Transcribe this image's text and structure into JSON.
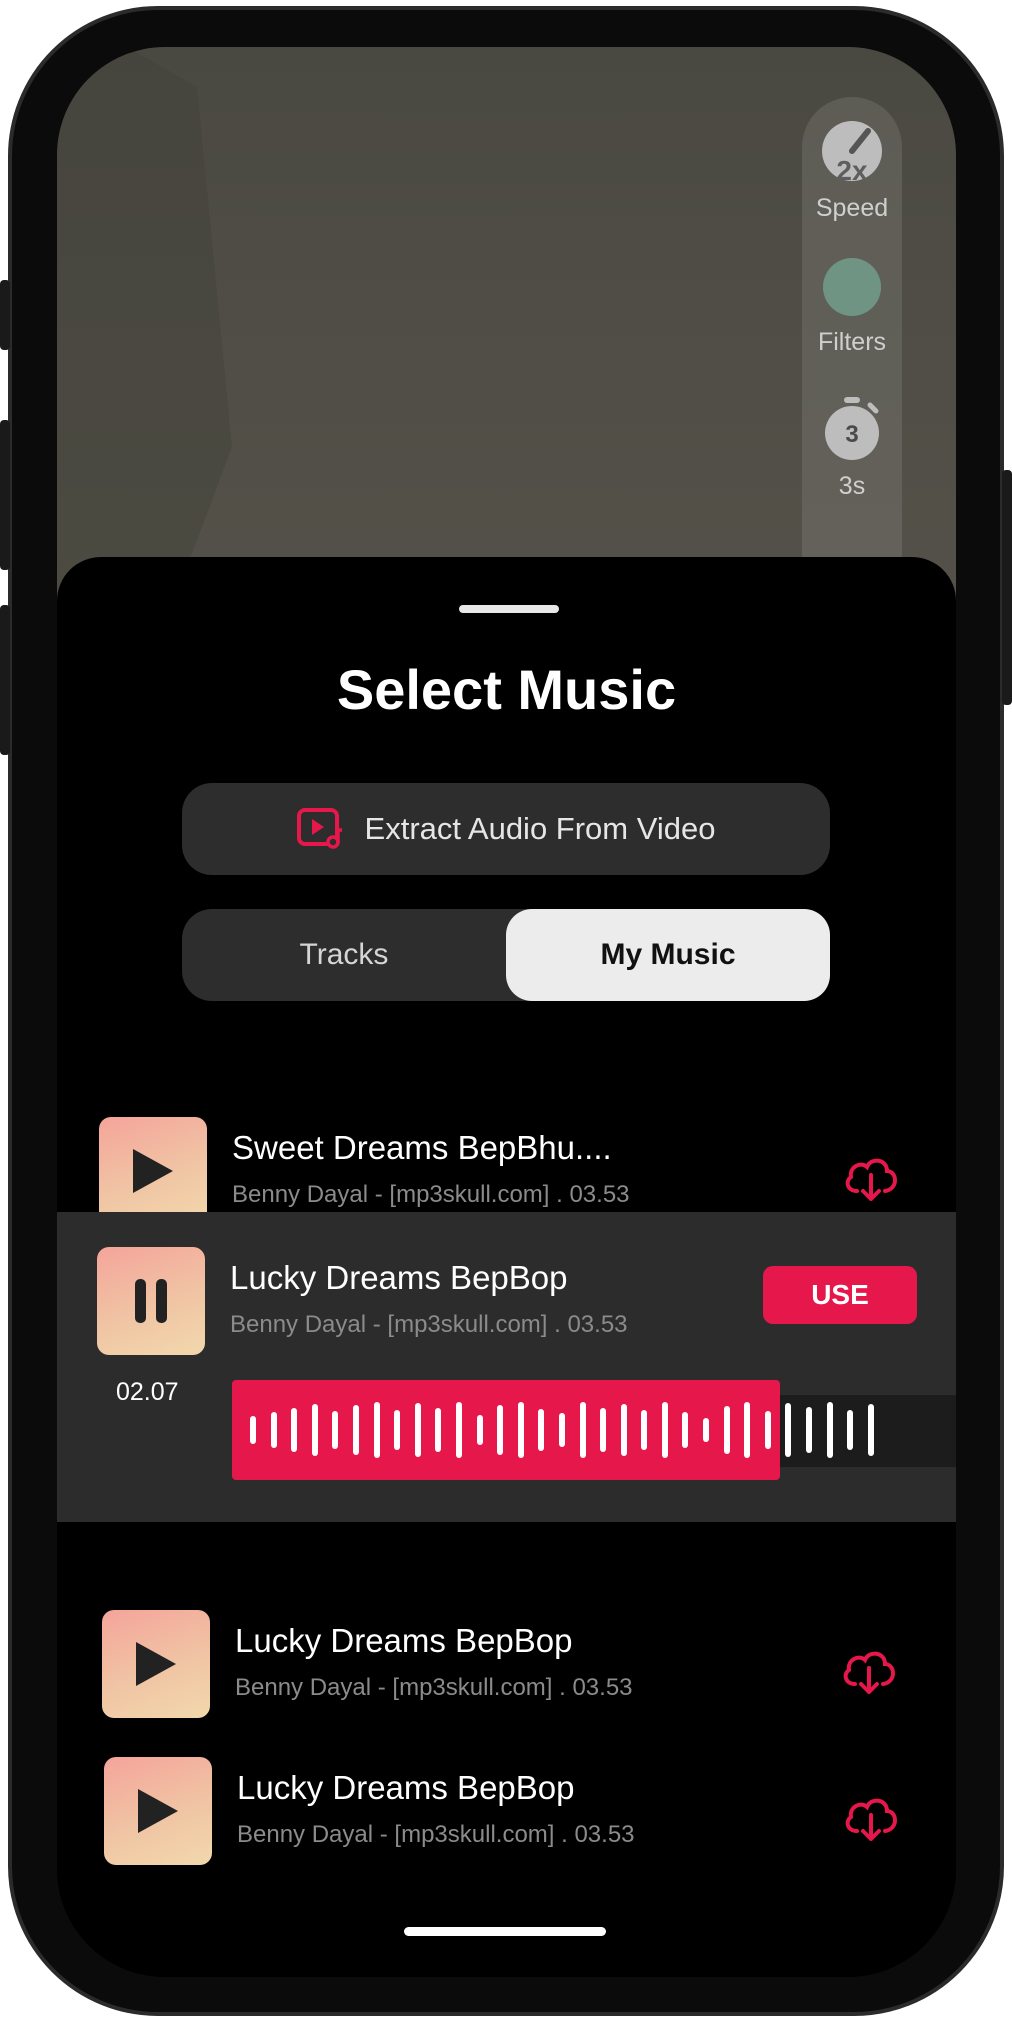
{
  "camera_tools": [
    {
      "label": "Speed",
      "badge": "2x",
      "icon": "speedometer-icon"
    },
    {
      "label": "Filters",
      "icon": "filter-icon"
    },
    {
      "label": "3s",
      "badge": "3",
      "icon": "timer-icon"
    }
  ],
  "sheet": {
    "title": "Select Music",
    "extract_label": "Extract Audio From Video",
    "tabs": {
      "tracks": "Tracks",
      "my_music": "My Music",
      "selected": "My Music"
    }
  },
  "songs": [
    {
      "title": "Sweet Dreams BepBhu....",
      "subtitle": "Benny Dayal - [mp3skull.com] . 03.53",
      "state": "play"
    },
    {
      "title": "Lucky Dreams BepBop",
      "subtitle": "Benny Dayal - [mp3skull.com] . 03.53",
      "state": "pause",
      "use_label": "USE",
      "time": "02.07"
    },
    {
      "title": "Lucky Dreams BepBop",
      "subtitle": "Benny Dayal - [mp3skull.com] . 03.53",
      "state": "play"
    },
    {
      "title": "Lucky Dreams BepBop",
      "subtitle": "Benny Dayal - [mp3skull.com] . 03.53",
      "state": "play"
    }
  ],
  "colors": {
    "accent": "#e6174b",
    "sheet_bg": "#000000",
    "pill_bg": "#2d2d2d"
  }
}
